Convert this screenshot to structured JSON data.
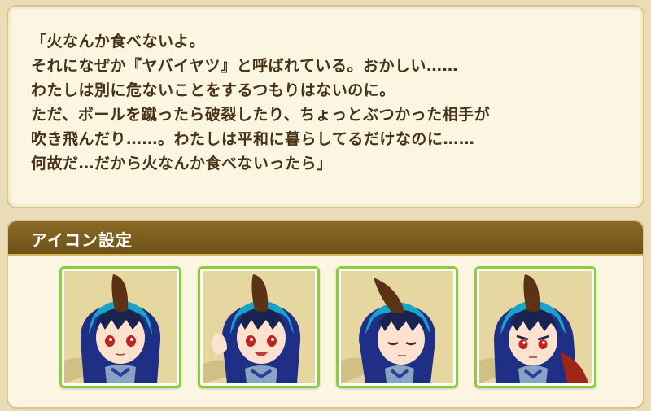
{
  "quote": {
    "lines": [
      "「火なんか食べないよ。",
      "それになぜか『ヤバイヤツ』と呼ばれている。おかしい……",
      "わたしは別に危ないことをするつもりはないのに。",
      "ただ、ボールを蹴ったら破裂したり、ちょっとぶつかった相手が",
      "吹き飛んだり……。わたしは平和に暮らしてるだけなのに……",
      "何故だ…だから火なんか食べないったら」"
    ]
  },
  "icon_settings": {
    "title": "アイコン設定",
    "icons": [
      {
        "expression": "neutral"
      },
      {
        "expression": "happy-salute"
      },
      {
        "expression": "eyes-closed"
      },
      {
        "expression": "serious"
      }
    ]
  },
  "colors": {
    "panel_bg": "#fbf5e1",
    "header_bg": "#7a5c1f",
    "card_border": "#8fce3b",
    "text": "#4a3217"
  }
}
